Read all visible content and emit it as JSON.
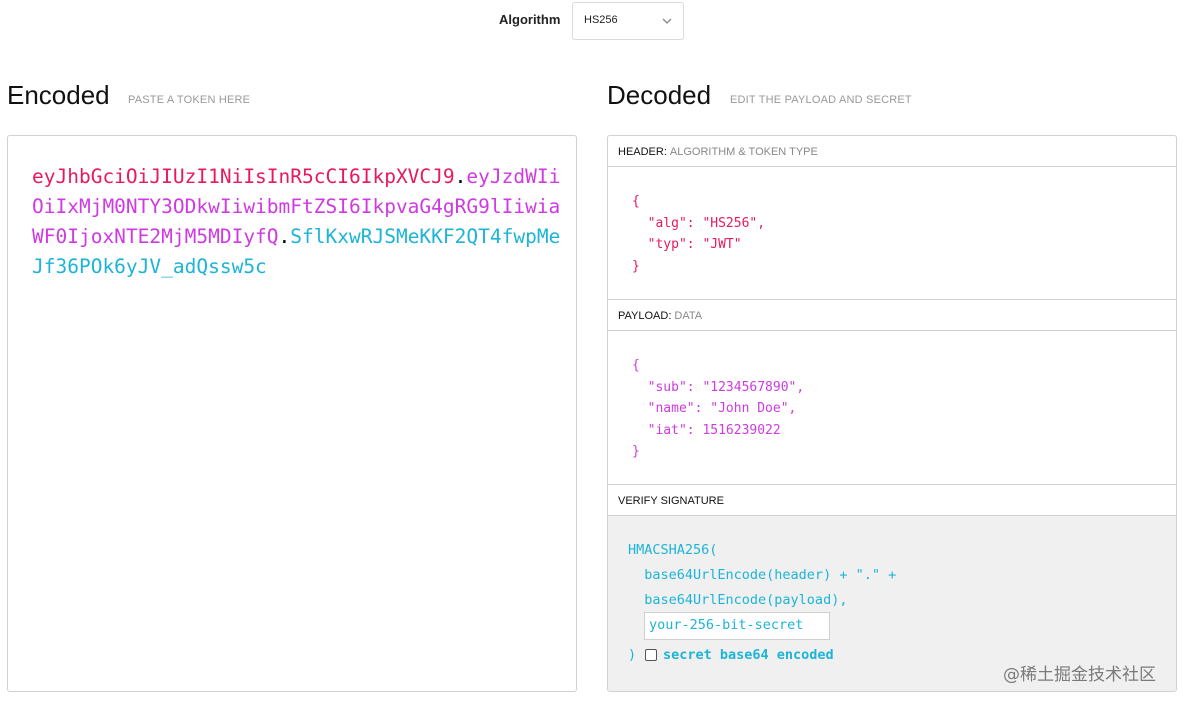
{
  "algorithm": {
    "label": "Algorithm",
    "selected": "HS256"
  },
  "encoded": {
    "title": "Encoded",
    "subtitle": "PASTE A TOKEN HERE",
    "token_header": "eyJhbGciOiJIUzI1NiIsInR5cCI6IkpXVCJ9",
    "token_payload": "eyJzdWIiOiIxMjM0NTY3ODkwIiwibmFtZSI6IkpvaG4gRG9lIiwiaWF0IjoxNTE2MjM5MDIyfQ",
    "token_signature": "SflKxwRJSMeKKF2QT4fwpMeJf36POk6yJV_adQssw5c",
    "dot": "."
  },
  "decoded": {
    "title": "Decoded",
    "subtitle": "EDIT THE PAYLOAD AND SECRET",
    "header_panel": {
      "label": "HEADER:",
      "sublabel": "ALGORITHM & TOKEN TYPE",
      "json": "{\n  \"alg\": \"HS256\",\n  \"typ\": \"JWT\"\n}"
    },
    "payload_panel": {
      "label": "PAYLOAD:",
      "sublabel": "DATA",
      "json": "{\n  \"sub\": \"1234567890\",\n  \"name\": \"John Doe\",\n  \"iat\": 1516239022\n}"
    },
    "verify_panel": {
      "label": "VERIFY SIGNATURE",
      "code": "HMACSHA256(\n  base64UrlEncode(header) + \".\" +\n  base64UrlEncode(payload),",
      "secret_placeholder": "your-256-bit-secret",
      "close_paren": ")",
      "base64_label": "secret base64 encoded"
    }
  },
  "watermark": "@稀土掘金技术社区",
  "colors": {
    "header": "#e8195e",
    "payload": "#cf3ae2",
    "signature": "#1db4d6"
  }
}
